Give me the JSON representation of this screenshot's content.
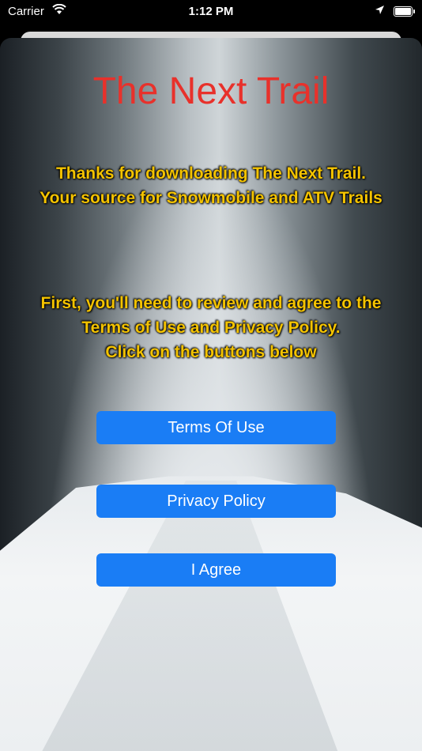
{
  "status_bar": {
    "carrier": "Carrier",
    "time": "1:12 PM",
    "icons": [
      "wifi-icon",
      "location-arrow-icon",
      "battery-icon"
    ]
  },
  "screen": {
    "title": "The Next Trail",
    "intro_text": "Thanks for downloading The Next Trail.\nYour source for Snowmobile and ATV Trails",
    "instructions_text": "First, you'll need to review and agree to the Terms of Use and Privacy Policy.\nClick on the buttons below"
  },
  "buttons": {
    "terms_label": "Terms Of Use",
    "privacy_label": "Privacy Policy",
    "agree_label": "I Agree"
  },
  "colors": {
    "title": "#e8312b",
    "body_text": "#f4c300",
    "button_bg": "#1a7df5",
    "button_text": "#ffffff"
  }
}
